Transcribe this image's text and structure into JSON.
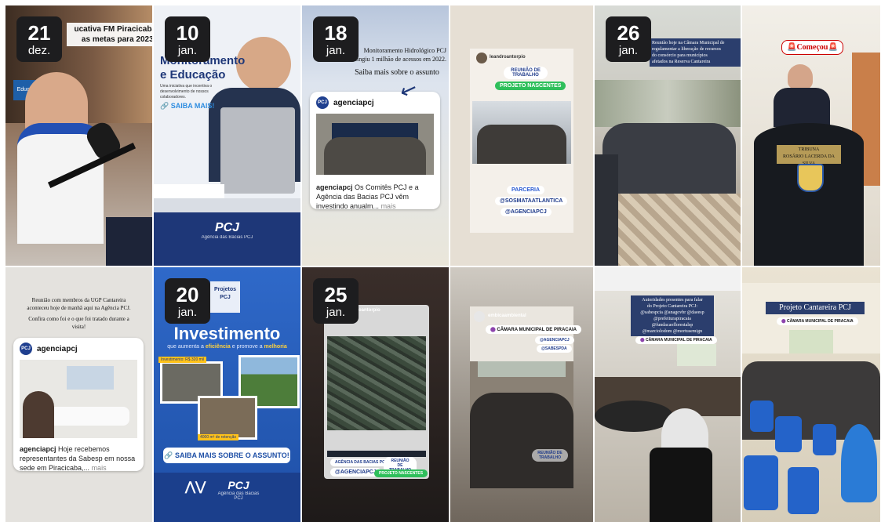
{
  "tiles": {
    "t1": {
      "day": "21",
      "month": "dez.",
      "headline_line1": "ucativa FM Piracicaba",
      "headline_line2": "as metas para 2023!",
      "studio_sign": "Educativa"
    },
    "t2": {
      "day": "10",
      "month": "jan.",
      "title_line1": "Monitoramento",
      "title_line2": "e Educação",
      "subtitle": "Uma iniciativa que incentiva o desenvolvimento de nossos colaboradores.",
      "cta": "SAIBA MAIS!",
      "logo": "PCJ",
      "logo_sub": "Agência das Bacias PCJ"
    },
    "t3": {
      "day": "18",
      "month": "jan.",
      "cap_line1": "Monitoramento Hidrológico PCJ",
      "cap_line2": "atingiu 1 milhão de acessos em 2022.",
      "cap_line3": "Saiba mais sobre o assunto",
      "account": "agenciapcj",
      "post_user": "agenciapcj",
      "post_text": "Os Comitês PCJ e a Agência das Bacias PCJ vêm investindo anualm...",
      "more": "mais"
    },
    "t4": {
      "account": "leandroantorpio",
      "tag_reuniao": "REUNIÃO DE TRABALHO",
      "tag_projeto": "PROJETO NASCENTES",
      "tag_parceria": "PARCERIA",
      "tag_sos": "@SOSMATAATLANTICA",
      "tag_agencia": "@AGENCIAPCJ"
    },
    "t5": {
      "day": "26",
      "month": "jan.",
      "cap_line1": "Reunião hoje na Câmara Municipal de",
      "cap_line2": "regulamentar a liberação de recursos",
      "cap_line3": "do consórcio para municípios",
      "cap_line4": "afetados na Reserva Cantareira"
    },
    "t6": {
      "started": "Começou",
      "podium_line1": "TRIBUNA",
      "podium_line2": "ROSÁRIO LACERDA DA SILVA"
    },
    "t7": {
      "cap_line1": "Reunião com membros da UGP Cantareira",
      "cap_line2": "aconteceu hoje de manhã aqui na Agência PCJ.",
      "cap_line3": "Confira como foi e o que foi tratado durante a",
      "cap_line4": "visita!",
      "account": "agenciapcj",
      "post_user": "agenciapcj",
      "post_text": "Hoje recebemos representantes da Sabesp em nossa sede em Piracicaba,...",
      "more": "mais"
    },
    "t8": {
      "day": "20",
      "month": "jan.",
      "badge_line1": "Projetos",
      "badge_line2": "PCJ",
      "title": "Investimento",
      "sub_pre": "que aumenta a ",
      "sub_hl1": "eficiência",
      "sub_mid": " e promove a ",
      "sub_hl2": "melhoria",
      "amount1": "Investimento: R$ 320 mil",
      "amount2": "4000 m³ de retenção",
      "cta": "SAIBA MAIS SOBRE O ASSUNTO!",
      "logo": "PCJ",
      "logo_sub": "Agência das Bacias PCJ"
    },
    "t9": {
      "day": "25",
      "month": "jan.",
      "account": "leandroantorpio",
      "tag_agencia_bacias": "AGÊNCIA DAS BACIAS PCJ",
      "tag_agenciapcj": "@AGENCIAPCJ",
      "tag_reuniao": "REUNIÃO DE TRABALHO",
      "tag_projeto": "PROJETO NASCENTES"
    },
    "t10": {
      "account": "embicaambiental",
      "location": "CÂMARA MUNICIPAL DE PIRACAIA",
      "tag1": "@AGENCIAPCJ",
      "tag2": "@SABESPDA",
      "bottom_tag": "REUNIÃO DE TRABALHO"
    },
    "t11": {
      "cap_line1": "Autoridades presentes para falar",
      "cap_line2": "do Projeto Cantareira PCJ:",
      "cap_line3": "@sabespcia @anagovbr @daeesp",
      "cap_line4": "@prefeiturapiracaia",
      "cap_line5": "@fundacaoflorestalsp",
      "cap_line6": "@marciolodom @mortusemign",
      "location": "CÂMARA MUNICIPAL DE PIRACAIA"
    },
    "t12": {
      "title": "Projeto Cantareira PCJ",
      "location": "CÂMARA MUNICIPAL DE PIRACAIA"
    }
  }
}
